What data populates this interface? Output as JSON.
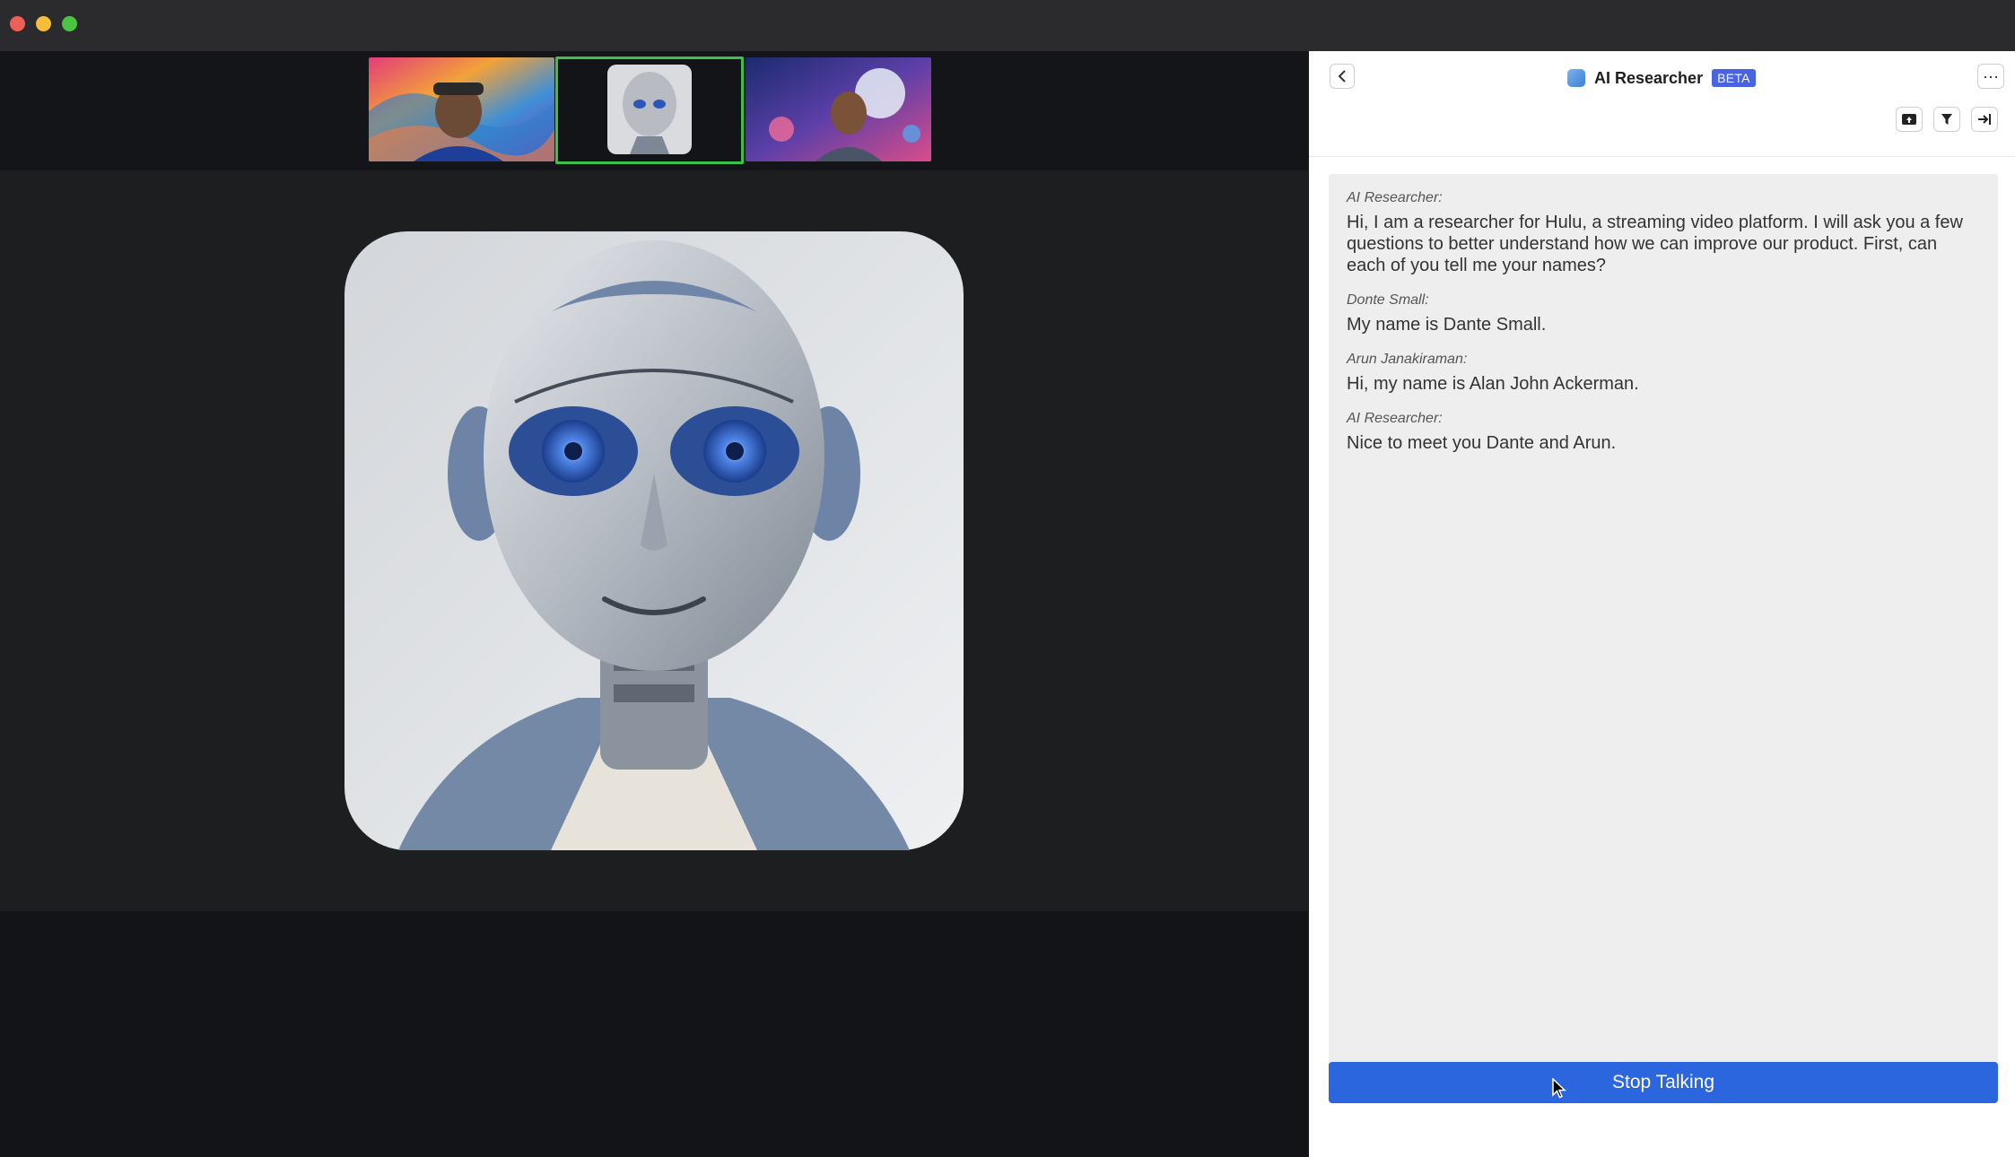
{
  "panel": {
    "title": "AI Researcher",
    "badge": "BETA",
    "more_label": "···"
  },
  "transcript": [
    {
      "speaker": "AI Researcher:",
      "text": "Hi, I am a researcher for Hulu, a streaming video platform. I will ask you a few questions to better understand how we can improve our product. First, can each of you tell me your names?"
    },
    {
      "speaker": "Donte Small:",
      "text": "My name is Dante Small."
    },
    {
      "speaker": "Arun Janakiraman:",
      "text": "Hi, my name is Alan John Ackerman."
    },
    {
      "speaker": "AI Researcher:",
      "text": "Nice to meet you Dante and Arun."
    }
  ],
  "actions": {
    "stop_label": "Stop Talking"
  },
  "colors": {
    "accent": "#2c66de",
    "beta_badge": "#4a63e0",
    "active_tile_border": "#3cc24a",
    "close": "#ee5f58",
    "minimize": "#f6bd3a",
    "maximize": "#4cc443"
  }
}
